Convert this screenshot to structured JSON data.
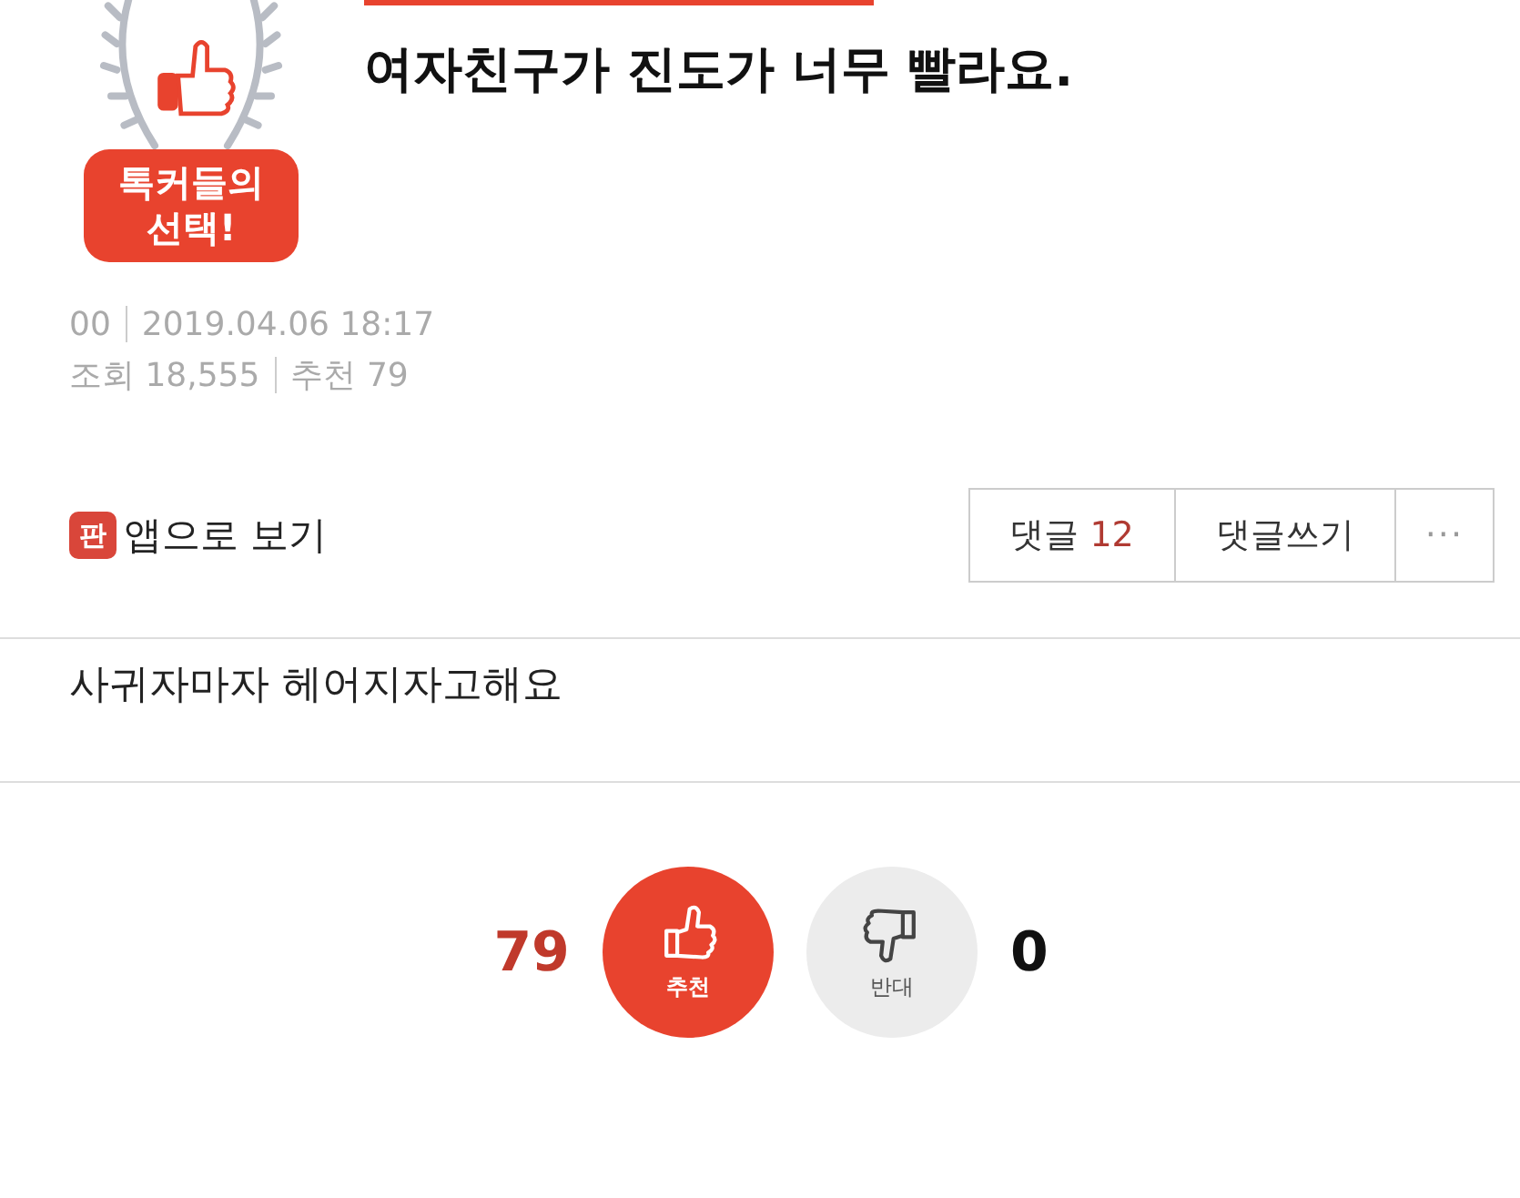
{
  "badge": {
    "lines": [
      "톡커들의",
      "선택!"
    ]
  },
  "title": "여자친구가 진도가 너무 빨라요.",
  "meta": {
    "author": "00",
    "date": "2019.04.06 18:17",
    "views": "조회 18,555",
    "recommends": "추천 79"
  },
  "app_link": {
    "icon": "판",
    "label": "앱으로 보기"
  },
  "actions": [
    {
      "kind": "count",
      "label": "댓글",
      "count": "12"
    },
    {
      "kind": "plain",
      "label": "댓글쓰기"
    },
    {
      "kind": "more",
      "label": "···"
    }
  ],
  "content": "사귀자마자 헤어지자고해요",
  "votes": [
    {
      "kind": "up",
      "count": "79",
      "label": "추천",
      "selected": true
    },
    {
      "kind": "down",
      "count": "0",
      "label": "반대",
      "selected": false
    }
  ]
}
